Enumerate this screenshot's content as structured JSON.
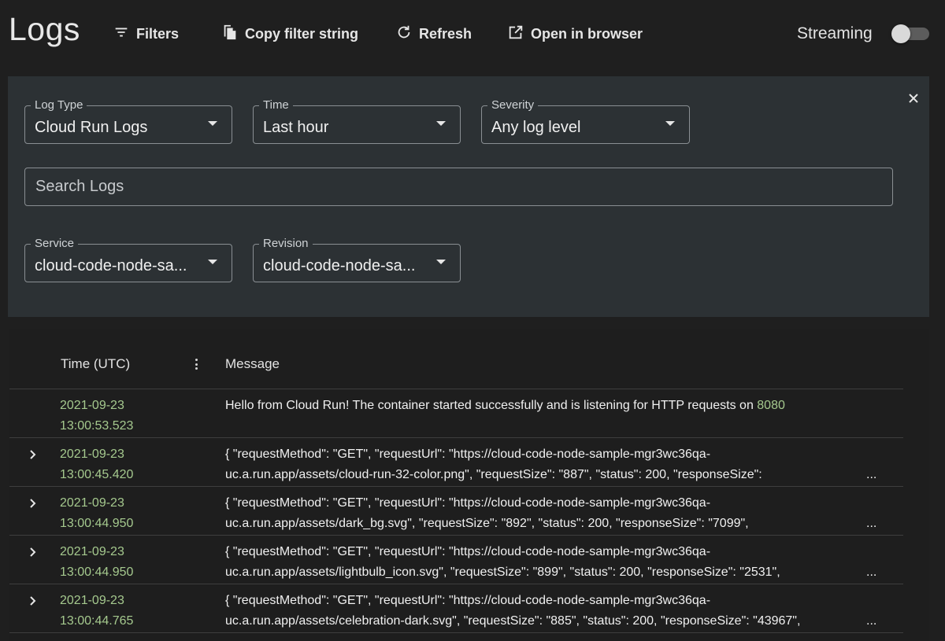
{
  "header": {
    "title": "Logs",
    "filters_label": "Filters",
    "copy_label": "Copy filter string",
    "refresh_label": "Refresh",
    "open_label": "Open in browser",
    "streaming_label": "Streaming",
    "streaming_on": false
  },
  "filters": {
    "log_type": {
      "label": "Log Type",
      "value": "Cloud Run Logs"
    },
    "time": {
      "label": "Time",
      "value": "Last hour"
    },
    "severity": {
      "label": "Severity",
      "value": "Any log level"
    },
    "search_placeholder": "Search Logs",
    "service": {
      "label": "Service",
      "value": "cloud-code-node-sa..."
    },
    "revision": {
      "label": "Revision",
      "value": "cloud-code-node-sa..."
    }
  },
  "table": {
    "col_time": "Time (UTC)",
    "col_message": "Message",
    "rows": [
      {
        "date": "2021-09-23",
        "time": "13:00:53.523",
        "msg1": "Hello from Cloud Run! The container started successfully and is listening for HTTP requests on ",
        "port": "8080",
        "msg2": "",
        "ellipsis": ""
      },
      {
        "date": "2021-09-23",
        "time": "13:00:45.420",
        "msg1": "{ \"requestMethod\": \"GET\", \"requestUrl\": \"https://cloud-code-node-sample-mgr3wc36qa-",
        "port": "",
        "msg2": "uc.a.run.app/assets/cloud-run-32-color.png\", \"requestSize\": \"887\", \"status\": 200, \"responseSize\":",
        "ellipsis": "..."
      },
      {
        "date": "2021-09-23",
        "time": "13:00:44.950",
        "msg1": "{ \"requestMethod\": \"GET\", \"requestUrl\": \"https://cloud-code-node-sample-mgr3wc36qa-",
        "port": "",
        "msg2": "uc.a.run.app/assets/dark_bg.svg\", \"requestSize\": \"892\", \"status\": 200, \"responseSize\": \"7099\",",
        "ellipsis": "..."
      },
      {
        "date": "2021-09-23",
        "time": "13:00:44.950",
        "msg1": "{ \"requestMethod\": \"GET\", \"requestUrl\": \"https://cloud-code-node-sample-mgr3wc36qa-",
        "port": "",
        "msg2": "uc.a.run.app/assets/lightbulb_icon.svg\", \"requestSize\": \"899\", \"status\": 200, \"responseSize\": \"2531\",",
        "ellipsis": "..."
      },
      {
        "date": "2021-09-23",
        "time": "13:00:44.765",
        "msg1": "{ \"requestMethod\": \"GET\", \"requestUrl\": \"https://cloud-code-node-sample-mgr3wc36qa-",
        "port": "",
        "msg2": "uc.a.run.app/assets/celebration-dark.svg\", \"requestSize\": \"885\", \"status\": 200, \"responseSize\": \"43967\",",
        "ellipsis": "..."
      }
    ]
  }
}
